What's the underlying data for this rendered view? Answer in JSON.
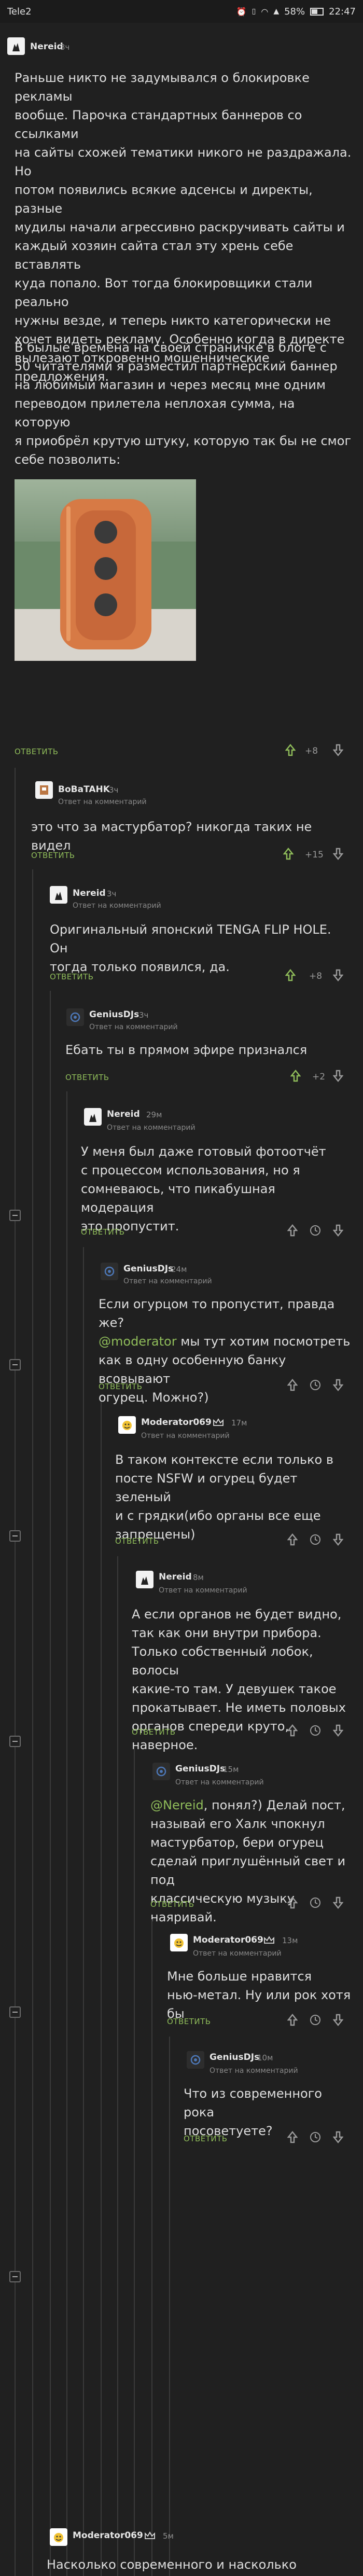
{
  "status_bar": {
    "carrier": "Tele2",
    "battery": "58%",
    "time": "22:47"
  },
  "labels": {
    "reply": "ОТВЕТИТЬ",
    "reply_to": "Ответ на комментарий"
  },
  "comments": [
    {
      "id": "c1",
      "user": "Nereid",
      "time": "3ч",
      "text_lines": [
        "Раньше никто не задумывался о блокировке рекламы",
        "вообще. Парочка стандартных баннеров со ссылками",
        "на сайты схожей тематики никого не раздражала. Но",
        "потом появились всякие адсенсы и директы, разные",
        "мудилы начали агрессивно раскручивать сайты и",
        "каждый хозяин сайта стал эту хрень себе вставлять",
        "куда попало. Вот тогда блокировщики стали реально",
        "нужны везде, и теперь никто категорически не",
        "хочет видеть рекламу. Особенно когда в директе",
        "вылезают откровенно мошеннические предложения."
      ],
      "text2_lines": [
        "В былые времена на своей страничке в блоге с",
        "50 читателями я разместил партнёрский баннер",
        "на любимый магазин и через месяц мне одним",
        "переводом прилетела неплохая сумма, на которую",
        "я приобрёл крутую штуку, которую так бы не смог",
        "себе позволить:"
      ],
      "rating": "+8"
    },
    {
      "id": "c2",
      "user": "BoBaTAHK",
      "time": "3ч",
      "text_lines": [
        "это что за мастурбатор? никогда таких не видел"
      ],
      "rating": "+15"
    },
    {
      "id": "c3",
      "user": "Nereid",
      "time": "3ч",
      "text_lines": [
        "Оригинальный японский TENGA FLIP HOLE. Он",
        "тогда только появился, да."
      ],
      "rating": "+8"
    },
    {
      "id": "c4",
      "user": "GeniusDJs",
      "time": "3ч",
      "text_lines": [
        "Ебать ты в прямом эфире признался"
      ],
      "rating": "+2"
    },
    {
      "id": "c5",
      "user": "Nereid",
      "time": "29м",
      "text_lines": [
        "У меня был даже готовый фотоотчёт",
        "с процессом использования, но я",
        "сомневаюсь, что пикабушная модерация",
        "это пропустит."
      ],
      "rating": ""
    },
    {
      "id": "c6",
      "user": "GeniusDJs",
      "time": "24м",
      "text_lines": [
        "Если огурцом то пропустит, правда же?"
      ],
      "mention": "@moderator",
      "text_after_mention": " мы тут хотим посмотреть",
      "text_rest_lines": [
        "как в одну особенную банку всовывают",
        "огурец. Можно?)"
      ],
      "rating": ""
    },
    {
      "id": "c7",
      "user": "Moderator069",
      "time": "17м",
      "text_lines": [
        "В таком контексте если только в",
        "посте NSFW и огурец будет зеленый",
        "и с грядки(ибо органы все еще",
        "запрещены)"
      ],
      "rating": ""
    },
    {
      "id": "c8",
      "user": "Nereid",
      "time": "8м",
      "text_lines": [
        "А если органов не будет видно,",
        "так как они внутри прибора.",
        "Только собственный лобок, волосы",
        "какие-то там. У девушек такое",
        "прокатывает. Не иметь половых",
        "органов спереди круто, наверное."
      ],
      "rating": ""
    },
    {
      "id": "c9",
      "user": "GeniusDJs",
      "time": "15м",
      "mention": "@Nereid",
      "text_after_mention": ", понял?) Делай пост,",
      "text_rest_lines": [
        "называй его Халк чпокнул",
        "мастурбатор, бери огурец",
        "сделай приглушённый свет и под",
        "классическую музыку наяривай."
      ],
      "rating": ""
    },
    {
      "id": "c10",
      "user": "Moderator069",
      "time": "13м",
      "text_lines": [
        "Мне больше нравится",
        "нью-метал. Ну или рок хотя бы"
      ],
      "rating": ""
    },
    {
      "id": "c11",
      "user": "GeniusDJs",
      "time": "10м",
      "text_lines": [
        "Что из современного рока",
        "посоветуете?"
      ],
      "rating": ""
    },
    {
      "id": "c12",
      "user": "Moderator069",
      "time": "5м",
      "text_lines": [
        "Насколько современного и насколько"
      ],
      "rating": ""
    }
  ]
}
